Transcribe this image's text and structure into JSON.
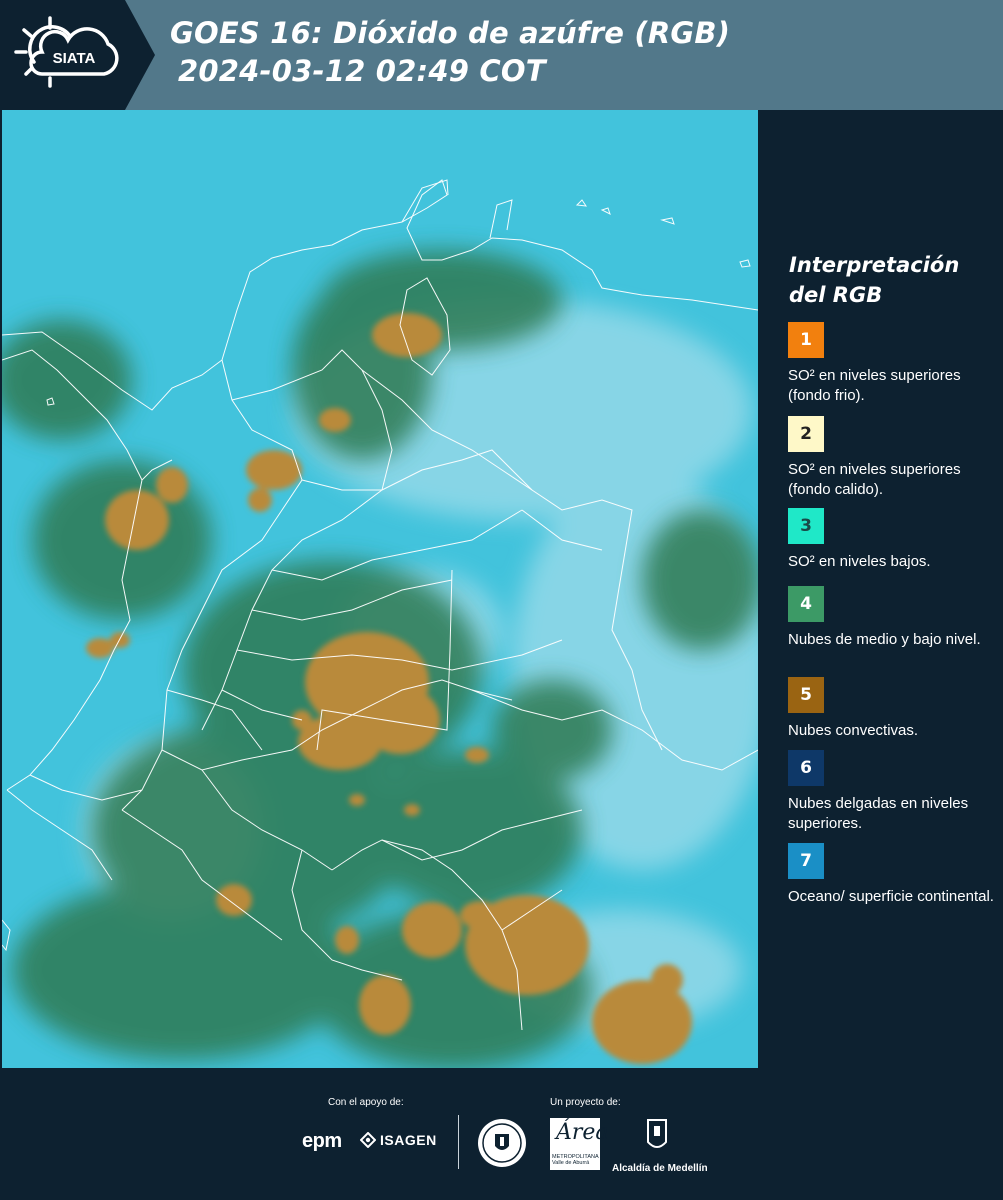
{
  "header": {
    "logo_text": "SIATA",
    "title_line1": "GOES 16: Dióxido de azúfre (RGB)",
    "title_line2": "2024-03-12 02:49 COT"
  },
  "legend": {
    "title_line1": "Interpretación",
    "title_line2": "del RGB",
    "items": [
      {
        "number": "1",
        "label": "SO² en niveles superiores (fondo frio).",
        "color": "#f2800e",
        "text_color": "#ffffff"
      },
      {
        "number": "2",
        "label": "SO² en niveles superiores (fondo calido).",
        "color": "#fef8c8",
        "text_color": "#222222"
      },
      {
        "number": "3",
        "label": "SO² en niveles bajos.",
        "color": "#1fe8c8",
        "text_color": "#1a4a48"
      },
      {
        "number": "4",
        "label": "Nubes de medio y bajo nivel.",
        "color": "#3c9a66",
        "text_color": "#ffffff"
      },
      {
        "number": "5",
        "label": "Nubes convectivas.",
        "color": "#9a6412",
        "text_color": "#ffffff"
      },
      {
        "number": "6",
        "label": "Nubes delgadas en niveles superiores.",
        "color": "#0e3868",
        "text_color": "#ffffff"
      },
      {
        "number": "7",
        "label": "Oceano/ superficie continental.",
        "color": "#1a8fc6",
        "text_color": "#ffffff"
      }
    ]
  },
  "map": {
    "ocean_color": "#42c3dc",
    "green_cloud_color": "#2e7a52",
    "convective_color": "#b98a3a",
    "light_cloud_color": "#9edcea",
    "border_color": "#ffffff"
  },
  "footer": {
    "support_label": "Con el apoyo de:",
    "project_label": "Un proyecto de:",
    "epm": "epm",
    "isagen": "ISAGEN",
    "amva_script": "Área",
    "amva_text_1": "METROPOLITANA",
    "amva_text_2": "Valle de Aburrá",
    "alcaldia": "Alcaldía de Medellín"
  }
}
